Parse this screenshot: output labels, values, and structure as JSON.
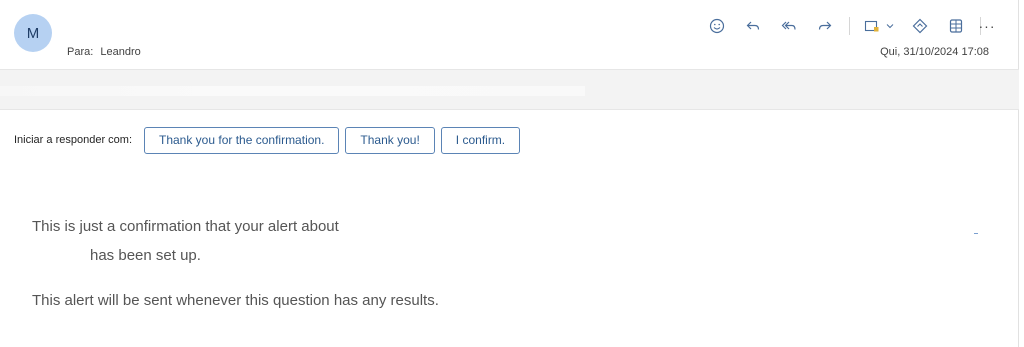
{
  "header": {
    "avatar_initial": "M",
    "to_label": "Para:",
    "to_name": "Leandro",
    "date": "Qui, 31/10/2024 17:08",
    "more_glyph": "···"
  },
  "toolbar_icons": [
    "emoji-icon",
    "reply-icon",
    "reply-all-icon",
    "forward-icon",
    "apps-icon",
    "chevron-down-icon",
    "loop-icon",
    "table-icon",
    "more-icon"
  ],
  "quick_replies": {
    "label": "Iniciar a responder com:",
    "options": [
      "Thank you for the confirmation.",
      "Thank you!",
      "I confirm."
    ]
  },
  "body": {
    "line1": "This is just a confirmation that your alert about",
    "line2": "has been set up.",
    "line3": "This alert will be sent whenever this question has any results."
  },
  "colors": {
    "accent": "#2b5a8e",
    "avatar_bg": "#b6d1f2",
    "icon": "#4a6e9c"
  }
}
